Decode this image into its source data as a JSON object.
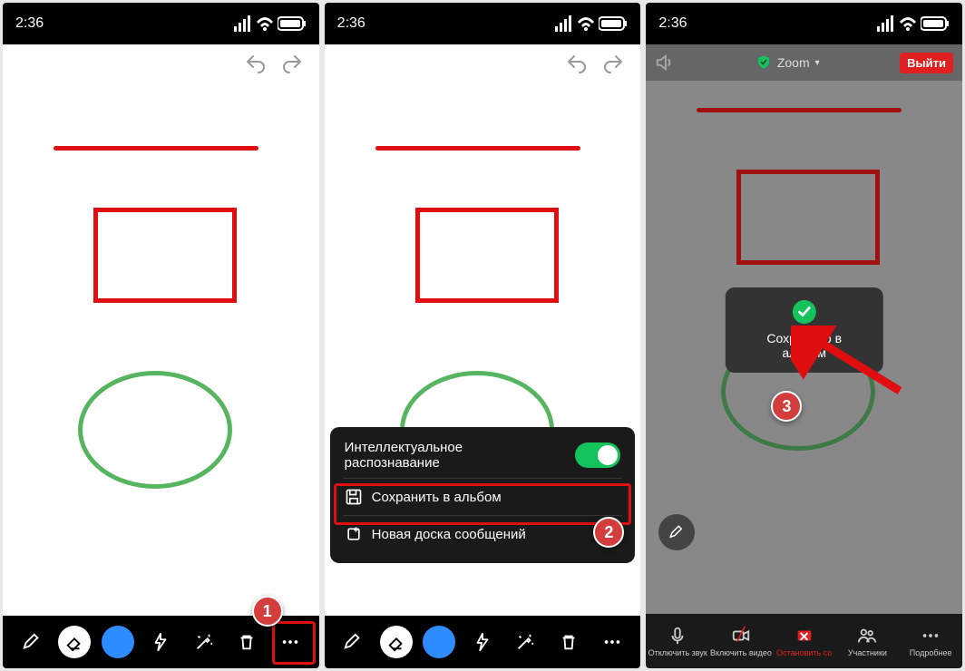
{
  "status": {
    "time": "2:36"
  },
  "popup": {
    "smart": "Интеллектуальное распознавание",
    "save": "Сохранить в альбом",
    "newboard": "Новая доска сообщений"
  },
  "screen3": {
    "zoom": "Zoom",
    "exit": "Выйти",
    "toast": "Сохранено в альбом",
    "bar": {
      "mute": "Отключить звук",
      "video": "Включить видео",
      "share": "Остановить со",
      "participants": "Участники",
      "more": "Подробнее"
    }
  },
  "steps": {
    "s1": "1",
    "s2": "2",
    "s3": "3"
  }
}
